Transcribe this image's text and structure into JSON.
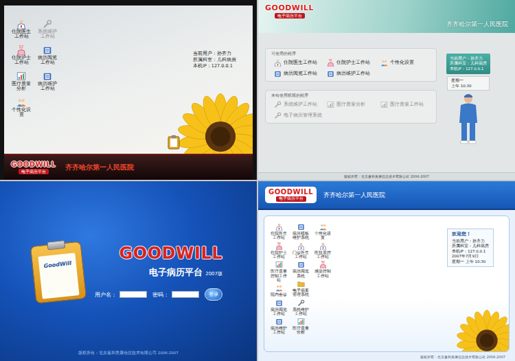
{
  "classic": {
    "logo": "GOODWILL",
    "logo_sub": "电子病历平台",
    "hospital": "齐齐哈尔第一人民医院",
    "icon_columns": [
      [
        {
          "label": "住院医生工作站",
          "kind": "doctor",
          "disabled": false
        },
        {
          "label": "住院护士工作站",
          "kind": "nurse",
          "disabled": false
        },
        {
          "label": "医疗质量分析",
          "kind": "chart",
          "disabled": false
        },
        {
          "label": "个性化设置",
          "kind": "users",
          "disabled": false
        }
      ],
      [
        {
          "label": "系统维护工作站",
          "kind": "tool",
          "disabled": true
        },
        {
          "label": "病历阅览工作站",
          "kind": "book",
          "disabled": false
        },
        {
          "label": "病历维护工作站",
          "kind": "book",
          "disabled": false
        }
      ]
    ],
    "info": [
      "当前用户：孙齐力",
      "所属科室：儿科病房",
      "本机IP：127.0.0.1"
    ]
  },
  "panels": {
    "logo": "GOODWILL",
    "logo_sub": "电子病历平台",
    "hospital": "齐齐哈尔第一人民医院",
    "available": {
      "title": "可使用的程序",
      "items": [
        {
          "label": "住院医生工作站",
          "kind": "doctor",
          "disabled": false
        },
        {
          "label": "住院护士工作站",
          "kind": "nurse",
          "disabled": false
        },
        {
          "label": "个性化设置",
          "kind": "users",
          "disabled": false
        },
        {
          "label": "病历阅览工作站",
          "kind": "book",
          "disabled": false
        },
        {
          "label": "病历维护工作站",
          "kind": "book",
          "disabled": false
        }
      ]
    },
    "unavailable": {
      "title": "未有使用权限的程序",
      "items": [
        {
          "label": "系统维护工作站",
          "kind": "tool",
          "disabled": true
        },
        {
          "label": "医疗质量分析",
          "kind": "chart",
          "disabled": true
        },
        {
          "label": "医疗质量工作站",
          "kind": "chart",
          "disabled": true
        },
        {
          "label": "电子病历管理系统",
          "kind": "tool",
          "disabled": true
        }
      ]
    },
    "user_info": [
      "当前用户：孙齐力",
      "所属科室：儿科病房",
      "本机IP：127.0.0.1"
    ],
    "day": "星期一",
    "time": "上午 10:30",
    "footer": "版权所有：北京嘉和美康信息技术有限公司 2006-2007"
  },
  "login": {
    "clipboard_label": "GoodWill",
    "logo": "GOODWILL",
    "title": "电子病历平台",
    "version": "2007版",
    "username_label": "用户名：",
    "password_label": "密码：",
    "button": "登录",
    "footer": "版权所有：北京嘉和美康信息技术有限公司 2006-2007"
  },
  "blue": {
    "logo": "GOODWILL",
    "logo_sub": "电子病历平台",
    "hospital": "齐齐哈尔第一人民医院",
    "icon_columns": [
      [
        {
          "label": "住院医生工作站",
          "kind": "doctor",
          "disabled": false
        },
        {
          "label": "住院护士工作站",
          "kind": "nurse",
          "disabled": false
        },
        {
          "label": "医疗质量控制工作站",
          "kind": "chart",
          "disabled": false
        },
        {
          "label": "院内会诊",
          "kind": "users",
          "disabled": false
        },
        {
          "label": "病历阅览工作站",
          "kind": "book",
          "disabled": false
        },
        {
          "label": "病历维护工作站",
          "kind": "book",
          "disabled": false
        }
      ],
      [
        {
          "label": "病历模板维护系统",
          "kind": "book",
          "disabled": false
        },
        {
          "label": "门诊医生工作站",
          "kind": "doctor",
          "disabled": false
        },
        {
          "label": "病历阅览系统",
          "kind": "book",
          "disabled": false
        },
        {
          "label": "电子病案管理系统",
          "kind": "folder",
          "disabled": false
        },
        {
          "label": "系统维护工作站",
          "kind": "tool",
          "disabled": false
        },
        {
          "label": "医疗质量分析",
          "kind": "chart",
          "disabled": false
        }
      ],
      [
        {
          "label": "个性化设置",
          "kind": "users",
          "disabled": false
        },
        {
          "label": "医技质控工作站",
          "kind": "doctor",
          "disabled": false
        },
        {
          "label": "感染控制工作站",
          "kind": "nurse",
          "disabled": false
        }
      ]
    ],
    "welcome": {
      "title": "欢迎您！",
      "lines": [
        "当前用户：孙齐力",
        "所属科室：儿科病房",
        "本机IP：127.0.0.1"
      ],
      "date": "2007年7月9日",
      "day_time": "星期一  上午 10:30"
    },
    "footer": "版权所有：北京嘉和美康信息技术有限公司 2006-2007"
  }
}
